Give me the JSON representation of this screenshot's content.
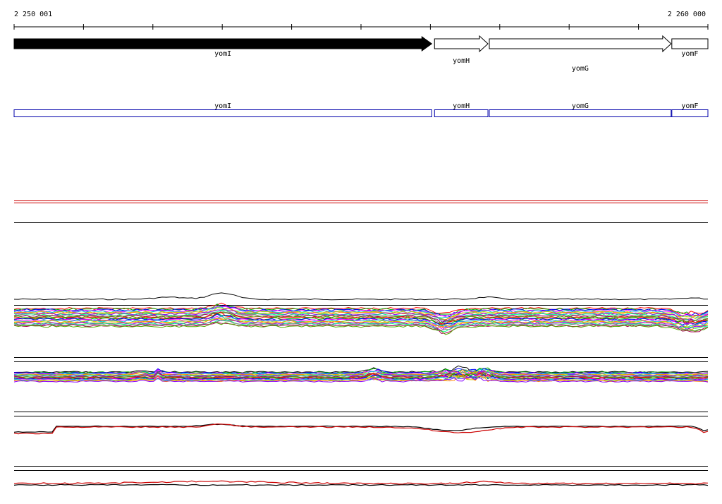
{
  "ruler": {
    "start_label": "2 250 001",
    "end_label": "2 260 000",
    "start": 2250001,
    "end": 2260000,
    "tick_count": 10
  },
  "genes": [
    {
      "name": "yomI",
      "start": 2250001,
      "end": 2256020,
      "strand": "+",
      "style": "filled"
    },
    {
      "name": "yomH",
      "start": 2256060,
      "end": 2256830,
      "strand": "+",
      "style": "outline"
    },
    {
      "name": "yomG",
      "start": 2256850,
      "end": 2259470,
      "strand": "+",
      "style": "outline"
    },
    {
      "name": "yomF",
      "start": 2259480,
      "end": 2260000,
      "strand": "+",
      "style": "outline"
    }
  ],
  "annotations": [
    {
      "name": "yomI",
      "start": 2250001,
      "end": 2256020
    },
    {
      "name": "yomH",
      "start": 2256060,
      "end": 2256830
    },
    {
      "name": "yomG",
      "start": 2256850,
      "end": 2259470
    },
    {
      "name": "yomF",
      "start": 2259480,
      "end": 2260000
    }
  ],
  "colors": {
    "gene_fill": "#000000",
    "annotation_box": "#0000aa",
    "track_line": "#000000",
    "highlight_line": "#cc0000",
    "series_palette": [
      "#ff0000",
      "#00aa00",
      "#0000ff",
      "#ff00ff",
      "#00cccc",
      "#cccc00",
      "#ff8800",
      "#8800ff",
      "#00ff88",
      "#888888",
      "#aa0055",
      "#55aa00"
    ]
  }
}
